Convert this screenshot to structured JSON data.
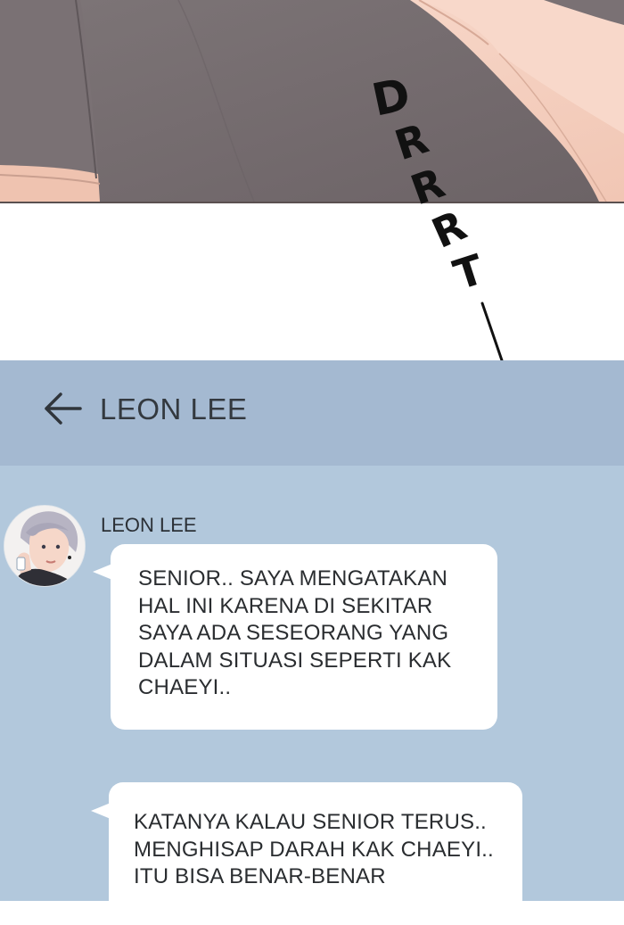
{
  "sound_effect": {
    "letters": [
      "D",
      "R",
      "R",
      "R",
      "T"
    ]
  },
  "chat": {
    "header": {
      "title": "LEON LEE",
      "back_icon": "left-arrow-icon"
    },
    "messages": [
      {
        "sender": "LEON LEE",
        "lines": [
          "SENIOR.. SAYA MENGATAKAN",
          "HAL INI KARENA DI SEKITAR",
          "SAYA ADA SESEORANG YANG",
          "DALAM SITUASI SEPERTI KAK",
          "CHAEYI.."
        ]
      },
      {
        "lines": [
          "KATANYA KALAU SENIOR TERUS..",
          "MENGHISAP DARAH KAK CHAEYI..",
          "ITU BISA BENAR-BENAR"
        ]
      }
    ]
  },
  "colors": {
    "header_bg": "#a4b9d1",
    "chat_bg": "#b2c8dc",
    "bubble_bg": "#ffffff"
  }
}
